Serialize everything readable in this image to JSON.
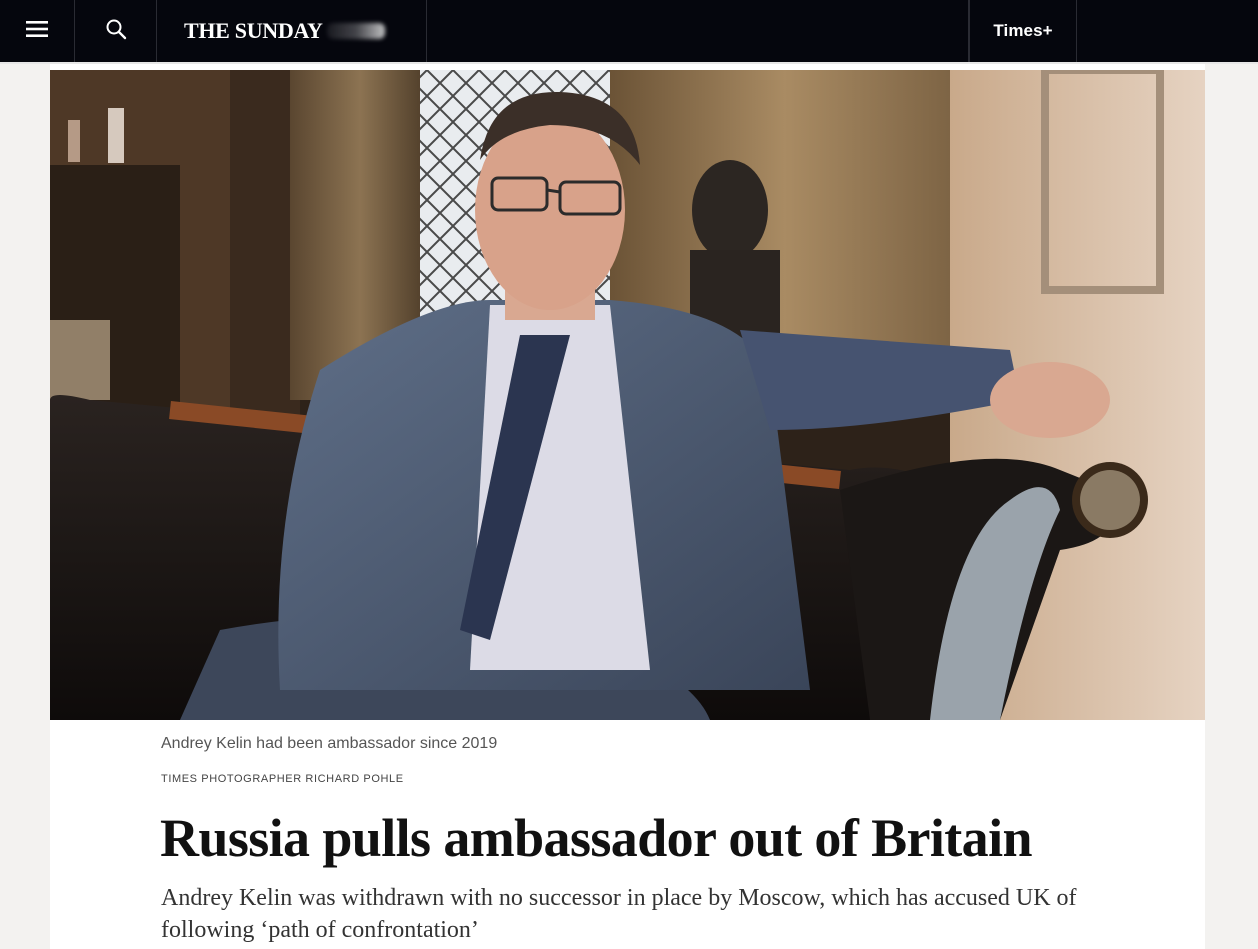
{
  "topbar": {
    "menu_icon": "hamburger-menu-icon",
    "search_icon": "search-icon",
    "logo_text": "THE SUNDAY",
    "times_plus_label": "Times+",
    "background": "#05060d"
  },
  "article": {
    "caption": "Andrey Kelin had been ambassador since 2019",
    "photo_credit": "TIMES PHOTOGRAPHER RICHARD POHLE",
    "headline": "Russia pulls ambassador out of Britain",
    "standfirst": "Andrey Kelin was withdrawn with no successor in place by Moscow, which has accused UK of following ‘path of confrontation’"
  }
}
